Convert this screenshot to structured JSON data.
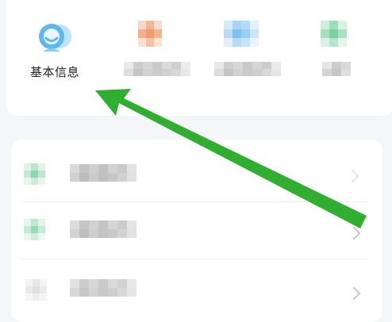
{
  "grid": {
    "items": [
      {
        "label": "基本信息",
        "icon": "user-profile-icon"
      },
      {
        "label": "",
        "icon": "orange-icon-obscured"
      },
      {
        "label": "",
        "icon": "blue-icon-obscured"
      },
      {
        "label": "",
        "icon": "green-icon-obscured"
      }
    ]
  },
  "list": {
    "rows": [
      {
        "label": "",
        "icon": "green-icon-obscured"
      },
      {
        "label": "",
        "icon": "green-icon-obscured"
      },
      {
        "label": "",
        "icon": "gray-icon-obscured"
      }
    ]
  },
  "annotation": {
    "type": "arrow",
    "color": "#2fae2f"
  },
  "colors": {
    "background": "#f5f6f8",
    "card": "#ffffff",
    "profile_icon": "#5bb8f0",
    "arrow": "#2fae2f"
  }
}
